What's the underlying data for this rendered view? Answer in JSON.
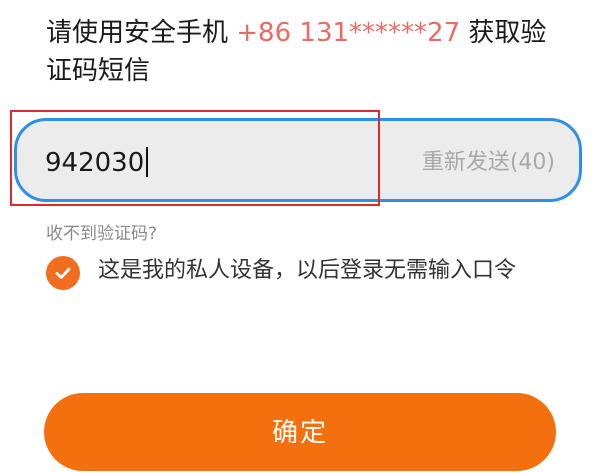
{
  "verification": {
    "prompt_prefix": "请使用安全手机 ",
    "phone": "+86 131******27",
    "prompt_suffix": " 获取验证码短信"
  },
  "code_field": {
    "value": "942030",
    "resend_label": "重新发送(40)"
  },
  "help_link": "收不到验证码?",
  "trusted_device": {
    "checked": true,
    "label": "这是我的私人设备，以后登录无需输入口令"
  },
  "confirm_button": "确定",
  "colors": {
    "accent_orange": "#f4700e",
    "focus_blue": "#2e8fe8",
    "phone_red": "#ee6a61",
    "highlight_red": "#e02a2a"
  },
  "icons": {
    "checkbox": "check-icon"
  }
}
